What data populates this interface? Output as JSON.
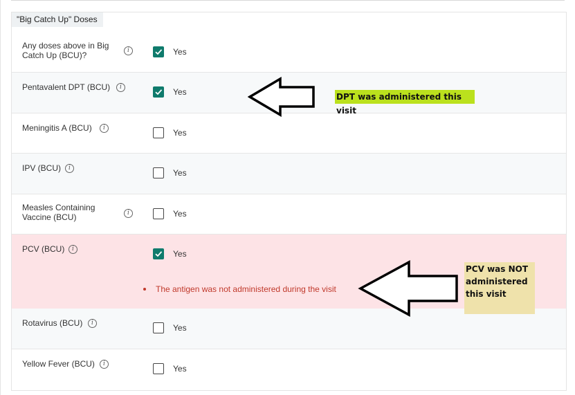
{
  "section": {
    "title": "\"Big Catch Up\" Doses"
  },
  "rows": [
    {
      "label": "Any doses above in Big Catch Up (BCU)?",
      "checked": true,
      "option": "Yes"
    },
    {
      "label": "Pentavalent DPT (BCU)",
      "checked": true,
      "option": "Yes"
    },
    {
      "label": "Meningitis A (BCU)",
      "checked": false,
      "option": "Yes"
    },
    {
      "label": "IPV (BCU)",
      "checked": false,
      "option": "Yes"
    },
    {
      "label": "Measles Containing Vaccine (BCU)",
      "checked": false,
      "option": "Yes"
    },
    {
      "label": "PCV (BCU)",
      "checked": true,
      "option": "Yes",
      "error": "The antigen was not administered during the visit"
    },
    {
      "label": "Rotavirus (BCU)",
      "checked": false,
      "option": "Yes"
    },
    {
      "label": "Yellow Fever (BCU)",
      "checked": false,
      "option": "Yes"
    }
  ],
  "annotations": {
    "dpt_note": "DPT was administered this visit",
    "pcv_note": "PCV was NOT administered this visit"
  },
  "colors": {
    "checkbox_checked": "#0f7b6c",
    "error_background": "#fde3e6",
    "error_text": "#c0392b",
    "dpt_note_highlight": "#bbe11d",
    "pcv_note_highlight": "#efe2ab"
  },
  "icons": {
    "info": "info-icon",
    "check": "check-icon",
    "arrow": "left-arrow-icon"
  }
}
